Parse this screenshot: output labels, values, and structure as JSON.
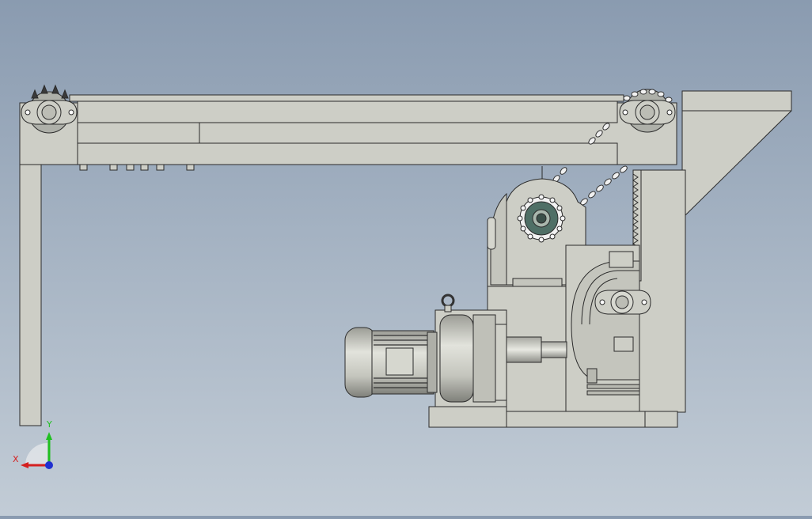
{
  "viewport": {
    "background_top": "#8a9bb0",
    "background_bottom": "#c2ccd6"
  },
  "model": {
    "fill": "#cdcec6",
    "stroke": "#2b2b2b",
    "motor_fill": "#bfc0b8",
    "sprocket_fill": "#4f6f66"
  },
  "triad": {
    "x_label": "X",
    "y_label": "Y",
    "x_color": "#d42020",
    "y_color": "#20c020",
    "z_color": "#2030d0"
  }
}
